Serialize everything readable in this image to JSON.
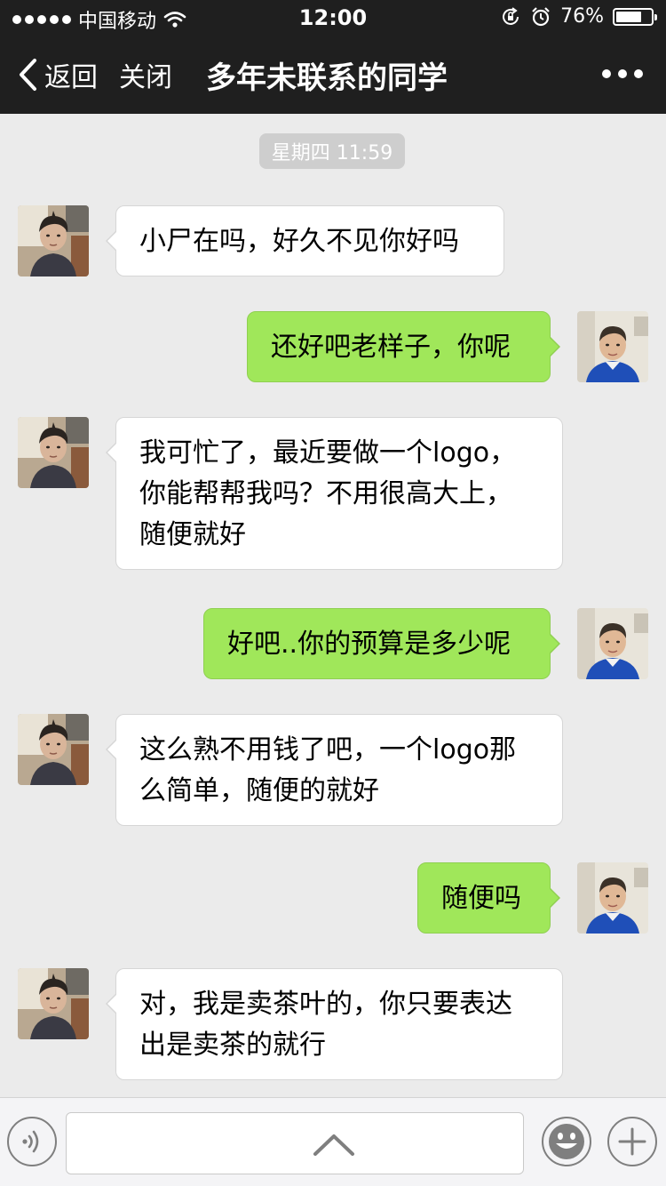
{
  "status_bar": {
    "carrier": "中国移动",
    "time": "12:00",
    "battery": "76%",
    "battery_level": 0.76,
    "icons": [
      "signal-dots-icon",
      "wifi-icon",
      "rotation-lock-icon",
      "alarm-icon",
      "battery-icon"
    ]
  },
  "navbar": {
    "back_label": "返回",
    "close_label": "关闭",
    "title": "多年未联系的同学",
    "icons": [
      "chevron-left-icon",
      "more-icon"
    ]
  },
  "chat": {
    "timestamp": "星期四 11:59",
    "messages": [
      {
        "side": "in",
        "lines": [
          "小尸在吗，好久不见你好吗"
        ]
      },
      {
        "side": "out",
        "lines": [
          "还好吧老样子，你呢"
        ]
      },
      {
        "side": "in",
        "lines": [
          "我可忙了，最近要做一个logo，",
          "你能帮帮我吗？不用很高大上，",
          "随便就好"
        ]
      },
      {
        "side": "out",
        "lines": [
          "好吧..你的预算是多少呢"
        ]
      },
      {
        "side": "in",
        "lines": [
          "这么熟不用钱了吧，一个logo那",
          "么简单，随便的就好"
        ]
      },
      {
        "side": "out",
        "lines": [
          "随便吗"
        ]
      },
      {
        "side": "in",
        "lines": [
          "对，我是卖茶叶的，你只要表达",
          "出是卖茶的就行"
        ]
      }
    ]
  },
  "input_bar": {
    "icons": [
      "voice-icon",
      "chevron-up-icon",
      "emoji-icon",
      "plus-icon"
    ]
  },
  "colors": {
    "header_bg": "#1f1f1f",
    "chat_bg": "#ebebeb",
    "incoming_bubble": "#ffffff",
    "outgoing_bubble": "#a0e75a",
    "timestamp_bg": "#cecece"
  }
}
